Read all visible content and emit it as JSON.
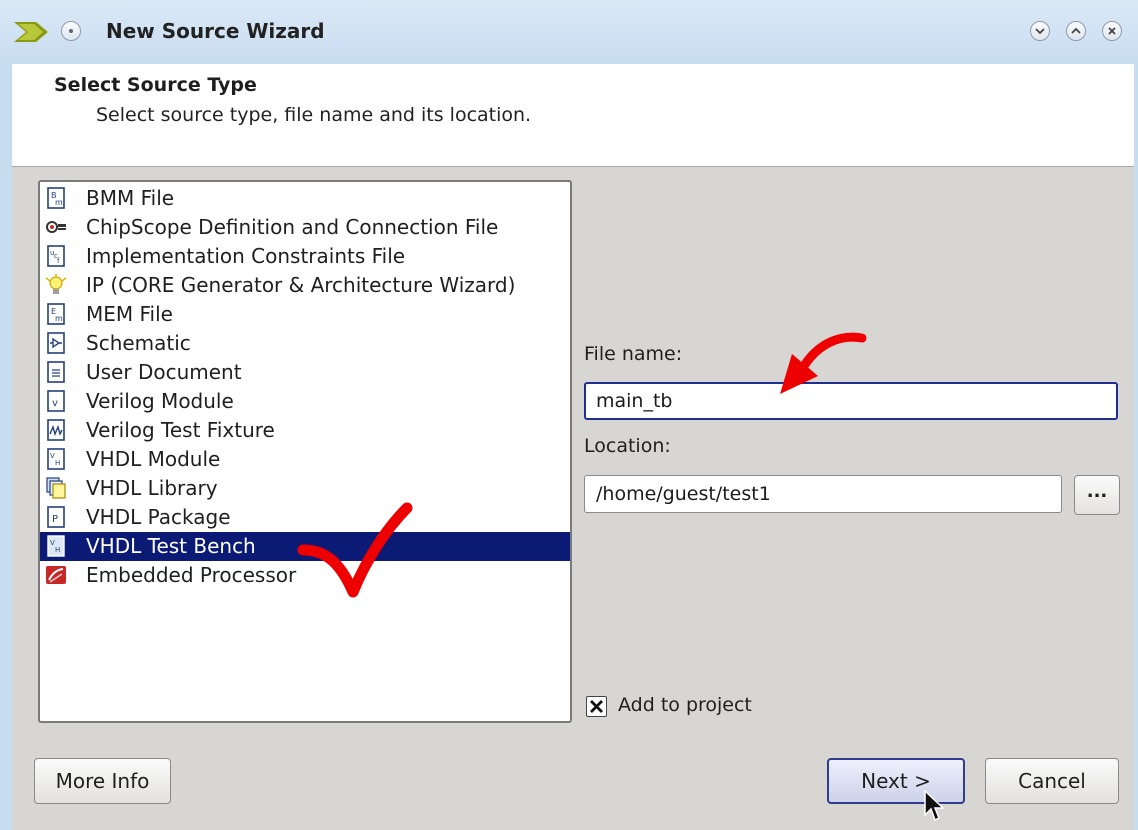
{
  "window": {
    "title": "New Source Wizard",
    "controls": [
      "minimize-icon",
      "maximize-icon",
      "close-icon"
    ]
  },
  "header": {
    "title": "Select Source Type",
    "subtitle": "Select source type, file name and its location."
  },
  "source_types": [
    {
      "label": "BMM File",
      "icon": "bmm-file-icon",
      "selected": false
    },
    {
      "label": "ChipScope Definition and Connection File",
      "icon": "chipscope-icon",
      "selected": false
    },
    {
      "label": "Implementation Constraints File",
      "icon": "ucf-file-icon",
      "selected": false
    },
    {
      "label": "IP (CORE Generator & Architecture Wizard)",
      "icon": "ip-core-icon",
      "selected": false
    },
    {
      "label": "MEM File",
      "icon": "mem-file-icon",
      "selected": false
    },
    {
      "label": "Schematic",
      "icon": "schematic-icon",
      "selected": false
    },
    {
      "label": "User Document",
      "icon": "document-icon",
      "selected": false
    },
    {
      "label": "Verilog Module",
      "icon": "verilog-module-icon",
      "selected": false
    },
    {
      "label": "Verilog Test Fixture",
      "icon": "verilog-test-fixture-icon",
      "selected": false
    },
    {
      "label": "VHDL Module",
      "icon": "vhdl-module-icon",
      "selected": false
    },
    {
      "label": "VHDL Library",
      "icon": "vhdl-library-icon",
      "selected": false
    },
    {
      "label": "VHDL Package",
      "icon": "vhdl-package-icon",
      "selected": false
    },
    {
      "label": "VHDL Test Bench",
      "icon": "vhdl-test-bench-icon",
      "selected": true
    },
    {
      "label": "Embedded Processor",
      "icon": "embedded-processor-icon",
      "selected": false
    }
  ],
  "form": {
    "file_name_label": "File name:",
    "file_name_value": "main_tb",
    "location_label": "Location:",
    "location_value": "/home/guest/test1",
    "browse_label": "...",
    "add_to_project_label": "Add to project",
    "add_to_project_checked": true
  },
  "buttons": {
    "more_info": "More Info",
    "next": "Next >",
    "cancel": "Cancel"
  },
  "colors": {
    "selection": "#0a1a75",
    "annotation": "#ee0000",
    "titlebar": "#c8dcf0"
  }
}
